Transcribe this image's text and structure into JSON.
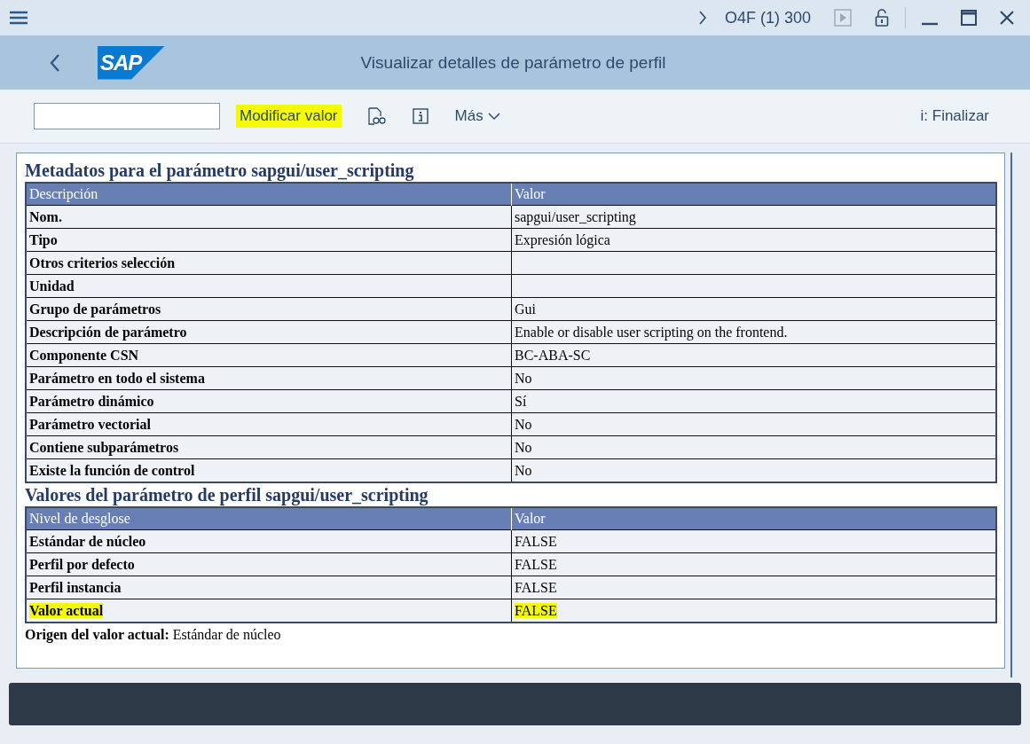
{
  "window": {
    "system": "O4F (1) 300",
    "logo": "SAP",
    "title": "Visualizar detalles de parámetro de perfil"
  },
  "toolbar": {
    "buttons": [
      {
        "label": "Modificar valor",
        "highlighted": true
      }
    ],
    "more": "Más",
    "exit": "i: Finalizar"
  },
  "sections": [
    {
      "title": "Metadatos para el parámetro sapgui/user_scripting",
      "columns": [
        "Descripción",
        "Valor"
      ],
      "rows": [
        {
          "label": "Nom.",
          "value": "sapgui/user_scripting",
          "highlighted": false
        },
        {
          "label": "Tipo",
          "value": "Expresión lógica",
          "highlighted": false
        },
        {
          "label": "Otros criterios selección",
          "highlighted": false
        },
        {
          "label": "Unidad",
          "highlighted": false
        },
        {
          "label": "Grupo de parámetros",
          "value": "Gui",
          "highlighted": false
        },
        {
          "label": "Descripción de parámetro",
          "value": "Enable or disable user scripting on the frontend.",
          "highlighted": false
        },
        {
          "label": "Componente CSN",
          "value": "BC-ABA-SC",
          "highlighted": false
        },
        {
          "label": "Parámetro en todo el sistema",
          "value": "No",
          "highlighted": false
        },
        {
          "label": "Parámetro dinámico",
          "value": "Sí",
          "highlighted": false
        },
        {
          "label": "Parámetro vectorial",
          "value": "No",
          "highlighted": false
        },
        {
          "label": "Contiene subparámetros",
          "value": "No",
          "highlighted": false
        },
        {
          "label": "Existe la función de control",
          "value": "No",
          "highlighted": false
        }
      ]
    },
    {
      "title": "Valores del parámetro de perfil sapgui/user_scripting",
      "columns": [
        "Nivel de desglose",
        "Valor"
      ],
      "rows": [
        {
          "label": "Estándar de núcleo",
          "value": "FALSE",
          "highlighted": false
        },
        {
          "label": "Perfil por defecto",
          "value": "FALSE",
          "highlighted": false
        },
        {
          "label": "Perfil instancia",
          "value": "FALSE",
          "highlighted": false
        },
        {
          "label": "Valor actual",
          "value": "FALSE",
          "highlighted": true
        }
      ]
    }
  ],
  "origin": "**Origen del valor actual:** Estándar de núcleo"
}
